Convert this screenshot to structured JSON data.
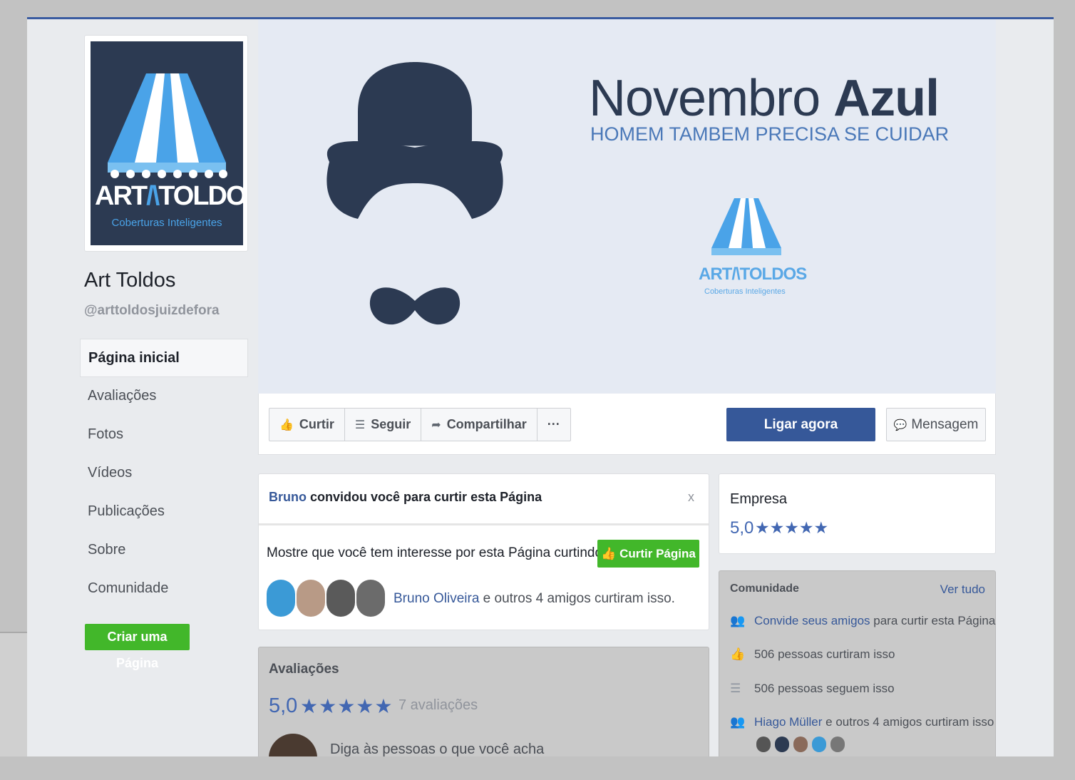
{
  "page": {
    "name": "Art Toldos",
    "handle": "@arttoldosjuizdefora",
    "logo_text": "ART",
    "logo_text2": "TOLDOS",
    "logo_sub": "Coberturas Inteligentes"
  },
  "nav": {
    "items": [
      {
        "label": "Página inicial"
      },
      {
        "label": "Avaliações"
      },
      {
        "label": "Fotos"
      },
      {
        "label": "Vídeos"
      },
      {
        "label": "Publicações"
      },
      {
        "label": "Sobre"
      },
      {
        "label": "Comunidade"
      }
    ],
    "create_page": "Criar uma Página"
  },
  "cover": {
    "title_regular": "Novembro ",
    "title_bold": "Azul",
    "subtitle": "HOMEM TAMBEM PRECISA SE CUIDAR",
    "logo_text": "ART/\\TOLDOS",
    "logo_sub": "Coberturas Inteligentes"
  },
  "actions": {
    "like": "Curtir",
    "follow": "Seguir",
    "share": "Compartilhar",
    "more": "···",
    "call": "Ligar agora",
    "message": "Mensagem"
  },
  "invite": {
    "inviter": "Bruno",
    "text": " convidou você para curtir esta Página",
    "close": "x",
    "prompt": "Mostre que você tem interesse por esta Página curtindo-a.",
    "like_page": "Curtir Página",
    "friend_name": "Bruno Oliveira",
    "friends_text": " e outros 4 amigos curtiram isso."
  },
  "reviews": {
    "title": "Avaliações",
    "score": "5,0",
    "stars": "★★★★★",
    "count": "7 avaliações",
    "prompt": "Diga às pessoas o que você acha"
  },
  "business": {
    "title": "Empresa",
    "score": "5,0",
    "stars": "★★★★★"
  },
  "community": {
    "title": "Comunidade",
    "see_all": "Ver tudo",
    "invite_link": "Convide seus amigos",
    "invite_rest": " para curtir esta Página",
    "likes": "506 pessoas curtiram isso",
    "follows": "506 pessoas seguem isso",
    "friend_name": "Hiago Müller",
    "friend_rest": " e outros 4 amigos curtiram isso"
  },
  "colors": {
    "brand_blue": "#365899",
    "green": "#42b72a",
    "navy": "#2c3a52"
  }
}
